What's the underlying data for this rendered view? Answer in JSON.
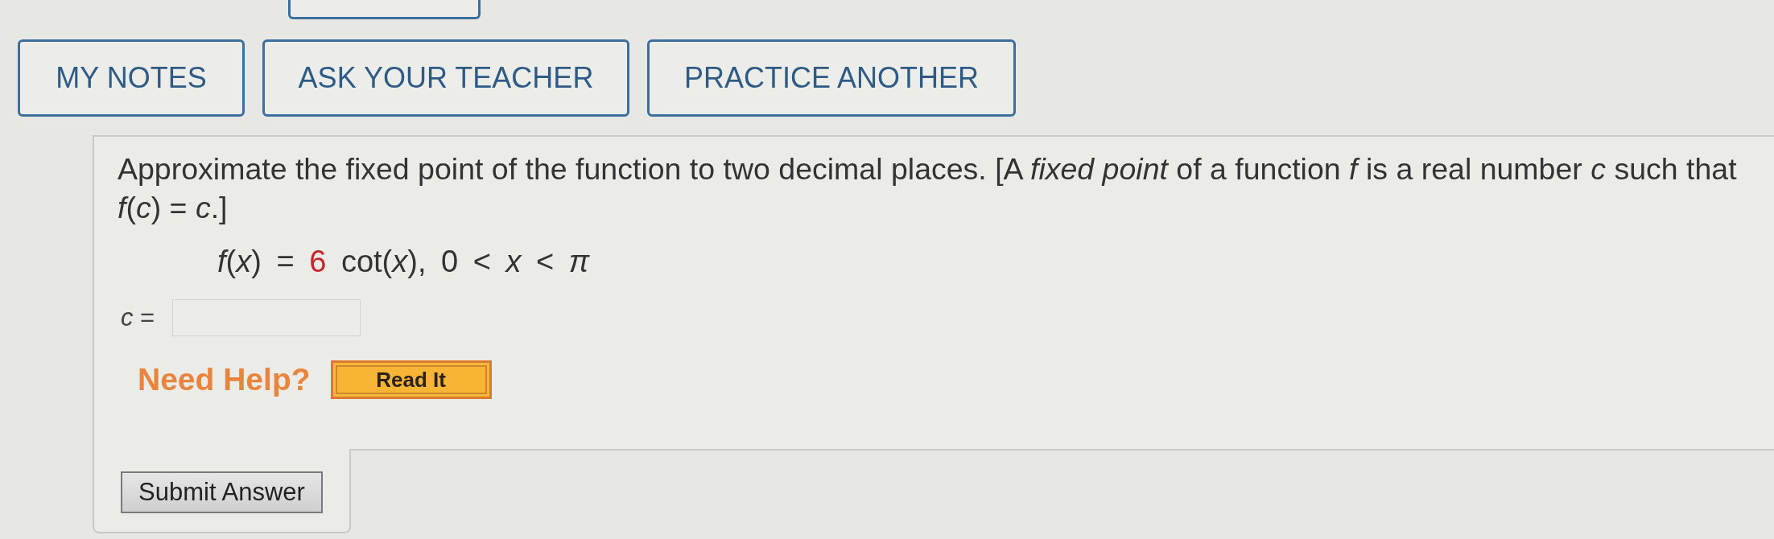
{
  "top_buttons": [
    {
      "label": "MY NOTES"
    },
    {
      "label": "ASK YOUR TEACHER"
    },
    {
      "label": "PRACTICE ANOTHER"
    }
  ],
  "question": {
    "prompt": "Approximate the fixed point of the function to two decimal places. [A *fixed point* of a function *f* is a real number *c* such that *f*(*c*) = *c*.]",
    "formula": {
      "parts": [
        {
          "text": "*f*(*x*) = ",
          "highlighted": false
        },
        {
          "text": "6",
          "highlighted": true
        },
        {
          "text": " cot(*x*), 0 < *x* < *π*",
          "highlighted": false
        }
      ]
    },
    "answer": {
      "label": "*c* ="
    }
  },
  "help": {
    "label": "Need Help?",
    "buttons": [
      {
        "label": "Read It"
      }
    ]
  },
  "submit": {
    "label": "Submit Answer"
  }
}
